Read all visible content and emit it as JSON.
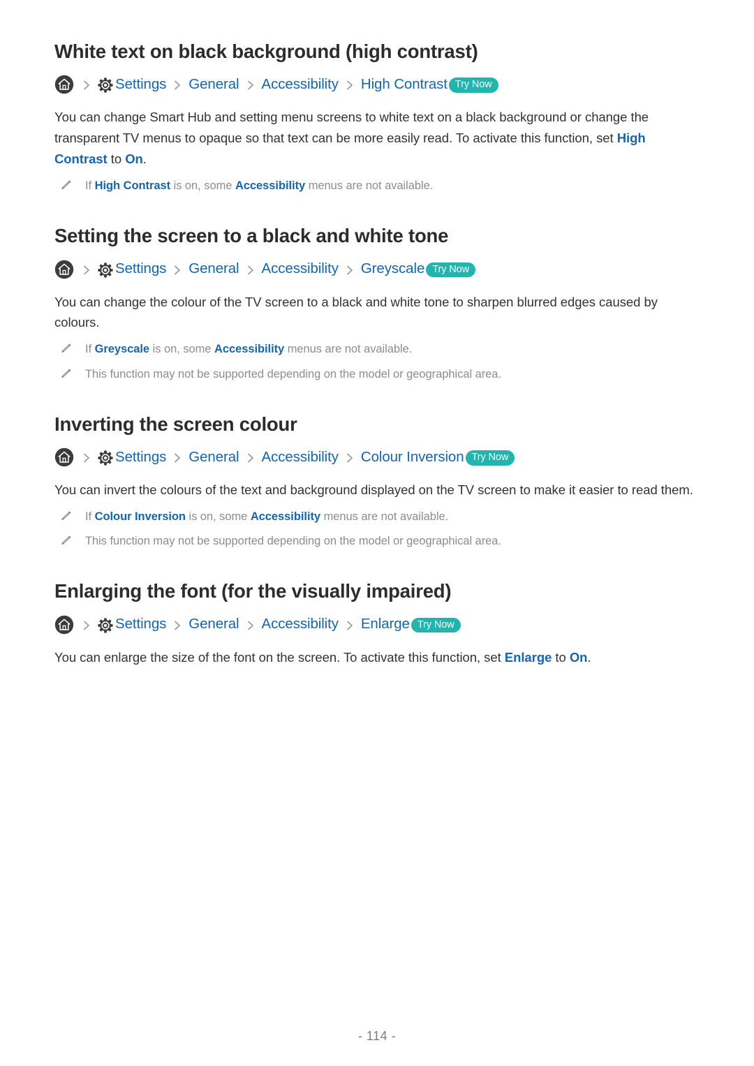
{
  "page": {
    "footer_label": "- 114 -",
    "page_number": 114,
    "colors": {
      "link_blue": "#1565b0",
      "heading_dark": "#2c2c2c",
      "body_text": "#333333",
      "note_gray": "#8d8d8d",
      "badge_teal": "#21b5ad",
      "badge_text": "#ffffff",
      "home_icon_dark": "#3c3c3c"
    }
  },
  "icons": {
    "home": "home-icon",
    "gear": "gear-icon",
    "separator": "chevron-right-icon",
    "note": "pencil-icon"
  },
  "sections": [
    {
      "heading": "White text on black background (high contrast)",
      "breadcrumb": {
        "items": [
          "Settings",
          "General",
          "Accessibility",
          "High Contrast"
        ],
        "badge": "Try Now"
      },
      "body": {
        "parts": [
          {
            "t": "You can change Smart Hub and setting menu screens to white text on a black background or change the transparent TV menus to opaque so that text can be more easily read. To activate this function, set ",
            "link": false
          },
          {
            "t": "High Contrast",
            "link": true
          },
          {
            "t": " to ",
            "link": false
          },
          {
            "t": "On",
            "link": true
          },
          {
            "t": ".",
            "link": false
          }
        ]
      },
      "notes": [
        {
          "parts": [
            {
              "t": "If ",
              "link": false
            },
            {
              "t": "High Contrast",
              "link": true
            },
            {
              "t": " is on, some ",
              "link": false
            },
            {
              "t": "Accessibility",
              "link": true
            },
            {
              "t": " menus are not available.",
              "link": false
            }
          ]
        }
      ]
    },
    {
      "heading": "Setting the screen to a black and white tone",
      "breadcrumb": {
        "items": [
          "Settings",
          "General",
          "Accessibility",
          "Greyscale"
        ],
        "badge": "Try Now"
      },
      "body": {
        "parts": [
          {
            "t": "You can change the colour of the TV screen to a black and white tone to sharpen blurred edges caused by colours.",
            "link": false
          }
        ]
      },
      "notes": [
        {
          "parts": [
            {
              "t": "If ",
              "link": false
            },
            {
              "t": "Greyscale",
              "link": true
            },
            {
              "t": " is on, some ",
              "link": false
            },
            {
              "t": "Accessibility",
              "link": true
            },
            {
              "t": " menus are not available.",
              "link": false
            }
          ]
        },
        {
          "parts": [
            {
              "t": "This function may not be supported depending on the model or geographical area.",
              "link": false
            }
          ]
        }
      ]
    },
    {
      "heading": "Inverting the screen colour",
      "breadcrumb": {
        "items": [
          "Settings",
          "General",
          "Accessibility",
          "Colour Inversion"
        ],
        "badge": "Try Now"
      },
      "body": {
        "parts": [
          {
            "t": "You can invert the colours of the text and background displayed on the TV screen to make it easier to read them.",
            "link": false
          }
        ]
      },
      "notes": [
        {
          "parts": [
            {
              "t": "If ",
              "link": false
            },
            {
              "t": "Colour Inversion",
              "link": true
            },
            {
              "t": " is on, some ",
              "link": false
            },
            {
              "t": "Accessibility",
              "link": true
            },
            {
              "t": " menus are not available.",
              "link": false
            }
          ]
        },
        {
          "parts": [
            {
              "t": "This function may not be supported depending on the model or geographical area.",
              "link": false
            }
          ]
        }
      ]
    },
    {
      "heading": "Enlarging the font (for the visually impaired)",
      "breadcrumb": {
        "items": [
          "Settings",
          "General",
          "Accessibility",
          "Enlarge"
        ],
        "badge": "Try Now"
      },
      "body": {
        "parts": [
          {
            "t": "You can enlarge the size of the font on the screen. To activate this function, set ",
            "link": false
          },
          {
            "t": "Enlarge",
            "link": true
          },
          {
            "t": " to ",
            "link": false
          },
          {
            "t": "On",
            "link": true
          },
          {
            "t": ".",
            "link": false
          }
        ]
      },
      "notes": []
    }
  ]
}
